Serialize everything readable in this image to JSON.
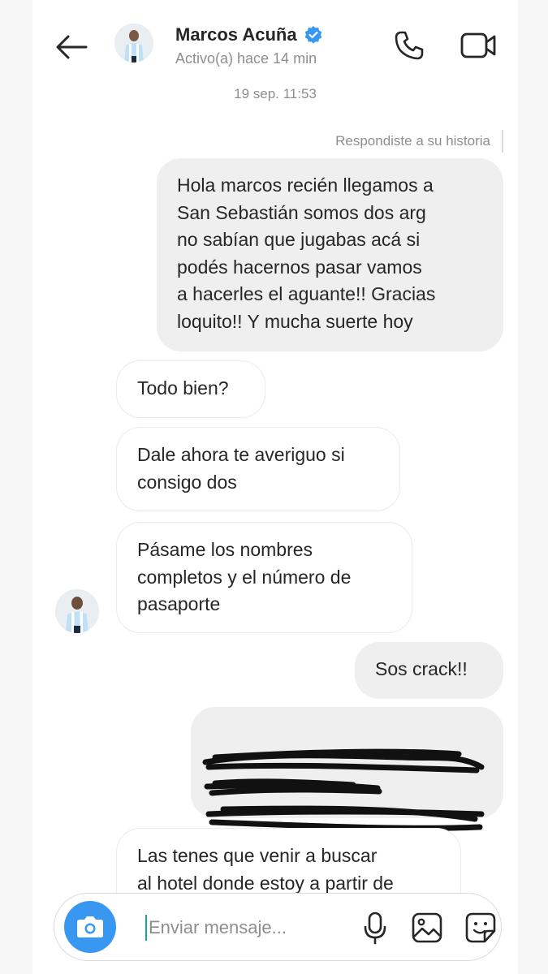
{
  "header": {
    "contact_name": "Marcos Acuña",
    "status": "Activo(a) hace 14 min",
    "back_icon": "back-arrow-icon",
    "call_icon": "phone-icon",
    "video_icon": "video-camera-icon",
    "verified_icon": "verified-badge-icon"
  },
  "conversation": {
    "timestamp": "19 sep. 11:53",
    "story_reply_note": "Respondiste a su historia",
    "messages": [
      {
        "from": "me",
        "text": "Hola marcos recién llegamos a\nSan Sebastián somos dos arg\nno sabían que jugabas acá si\npodés hacernos pasar vamos\na hacerles el aguante!! Gracias\nloquito!! Y mucha suerte hoy"
      },
      {
        "from": "them",
        "text": "Todo bien?"
      },
      {
        "from": "them",
        "text": "Dale ahora te averiguo si\nconsigo dos"
      },
      {
        "from": "them",
        "text": "Pásame los nombres\ncompletos y el número de\npasaporte"
      },
      {
        "from": "me",
        "text": "Sos crack!!"
      },
      {
        "from": "me",
        "text": "[redacted]"
      },
      {
        "from": "them",
        "text": "Las tenes que venir a buscar\nal hotel donde estoy a partir de"
      }
    ]
  },
  "composer": {
    "placeholder": "Enviar mensaje...",
    "camera_icon": "camera-icon",
    "mic_icon": "microphone-icon",
    "gallery_icon": "image-gallery-icon",
    "sticker_icon": "sticker-icon"
  },
  "colors": {
    "accent": "#3897f0",
    "outgoing_bubble": "#efefef",
    "incoming_border": "#ebebeb",
    "secondary_text": "#8e8e8e",
    "verified": "#3897f0"
  }
}
